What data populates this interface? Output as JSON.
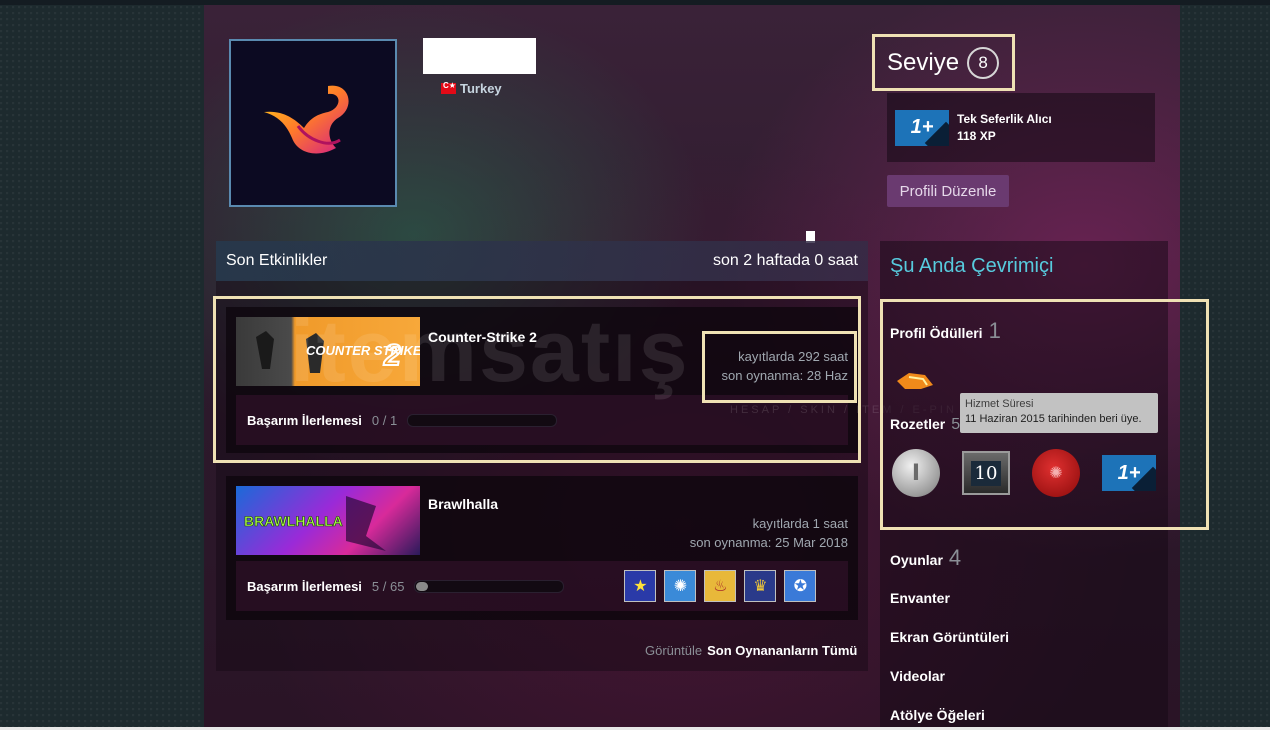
{
  "profile": {
    "country": "Turkey",
    "level_label": "Seviye",
    "level_value": "8"
  },
  "featured_badge": {
    "name": "Tek Seferlik Alıcı",
    "xp": "118 XP",
    "icon": "one-plus-badge-icon"
  },
  "edit_profile_label": "Profili Düzenle",
  "recent_activity": {
    "title": "Son Etkinlikler",
    "summary": "son 2 haftada 0 saat",
    "games": [
      {
        "name": "Counter-Strike 2",
        "logo_text": "COUNTER STRIKE",
        "hours": "kayıtlarda 292 saat",
        "last_played": "son oynanma: 28 Haz",
        "ach_label": "Başarım İlerlemesi",
        "ach_count": "0 / 1",
        "ach_progress": 0
      },
      {
        "name": "Brawlhalla",
        "logo_text": "BRAWLHALLA",
        "hours": "kayıtlarda 1 saat",
        "last_played": "son oynanma: 25 Mar 2018",
        "ach_label": "Başarım İlerlemesi",
        "ach_count": "5 / 65",
        "ach_progress": 0.077
      }
    ],
    "view_all_prefix": "Görüntüle",
    "view_all_link": "Son Oynananların Tümü"
  },
  "watermark": {
    "text": "itemsatış",
    "sub": "HESAP / SKIN / ITEM / E-PIN"
  },
  "sidebar": {
    "online_status": "Şu Anda Çevrimiçi",
    "awards_label": "Profil Ödülleri",
    "awards_count": "1",
    "badges_label": "Rozetler",
    "badges_count": "5",
    "tooltip_title": "Hizmet Süresi",
    "tooltip_text": "11 Haziran 2015 tarihinden beri üye.",
    "badge_ten": "10",
    "games_label": "Oyunlar",
    "games_count": "4",
    "inventory_label": "Envanter",
    "screenshots_label": "Ekran Görüntüleri",
    "videos_label": "Videolar",
    "workshop_label": "Atölye Öğeleri"
  },
  "colors": {
    "accent_blue": "#57cbde",
    "highlight": "#efe1b4",
    "edit_button": "#6a3a70"
  }
}
